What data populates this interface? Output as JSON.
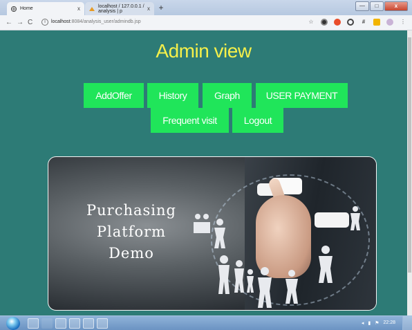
{
  "browser": {
    "tabs": [
      {
        "title": "Home",
        "active": true
      },
      {
        "title": "localhost / 127.0.0.1 / analysis | p",
        "active": false
      }
    ],
    "url_host": "localhost",
    "url_rest": ":8084/analysis_user/admindb.jsp",
    "new_tab_symbol": "+",
    "close_symbol": "x",
    "window_close_symbol": "x",
    "window_minimize_symbol": "—",
    "window_maximize_symbol": "□"
  },
  "page": {
    "title": "Admin view",
    "title_color": "#f5f04a",
    "background": "#2d7b76",
    "button_color": "#20e55a",
    "nav_buttons": [
      "AddOffer",
      "History",
      "Graph",
      "USER PAYMENT",
      "Frequent visit",
      "Logout"
    ],
    "banner_text": [
      "Purchasing",
      "Platform",
      "Demo"
    ]
  },
  "taskbar": {
    "clock": "22:28"
  }
}
